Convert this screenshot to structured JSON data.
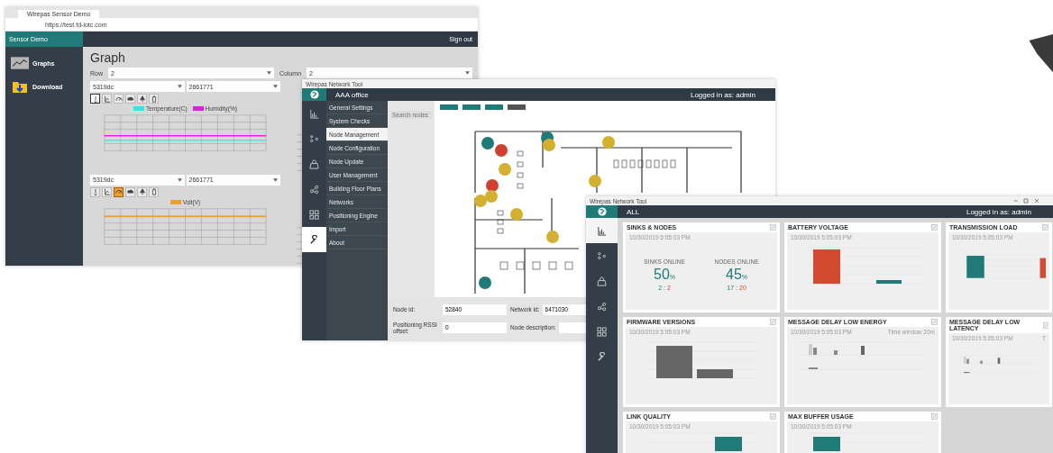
{
  "sensor_window": {
    "tab_title": "Wirepas Sensor Demo",
    "url": "https://test.fd-iotc.com",
    "app_name": "Sensor Demo",
    "sign_out": "Sign out",
    "sidebar": [
      {
        "label": "Graphs",
        "selected": true
      },
      {
        "label": "Download",
        "selected": false
      }
    ],
    "page_title": "Graph",
    "row": {
      "label": "Row",
      "value": "2"
    },
    "column": {
      "label": "Column",
      "value": "2"
    },
    "panels": [
      {
        "selects": [
          "5319dc",
          "2661771"
        ],
        "tools": [
          {
            "selected": true
          },
          {
            "selected": false
          },
          {
            "selected": false
          },
          {
            "selected": false
          },
          {
            "selected": false
          },
          {
            "selected": false
          }
        ],
        "legend": [
          {
            "name": "Temperature(C)",
            "color": "#3fe0e0"
          },
          {
            "name": "Humidity(%)",
            "color": "#e020e0"
          }
        ]
      },
      {
        "selects": [
          "5319dc",
          "2661771"
        ],
        "tools": [
          {
            "selected": false
          },
          {
            "selected": false
          },
          {
            "selected": true
          },
          {
            "selected": false
          },
          {
            "selected": false
          },
          {
            "selected": false
          }
        ],
        "legend": [
          {
            "name": "Volt(V)",
            "color": "#f0a030"
          }
        ]
      }
    ]
  },
  "network_window": {
    "window_title": "Wirepas Network Tool",
    "location": "AAA office",
    "login": "Logged in as: admin",
    "rail": [
      {
        "selected": false
      },
      {
        "selected": false
      },
      {
        "selected": false
      },
      {
        "selected": false
      },
      {
        "selected": false
      },
      {
        "selected": true
      }
    ],
    "menu": [
      {
        "label": "General Settings",
        "selected": false
      },
      {
        "label": "System Checks",
        "selected": false
      },
      {
        "label": "Node Management",
        "selected": true
      },
      {
        "label": "Node Configuration",
        "selected": false
      },
      {
        "label": "Node Update",
        "selected": false
      },
      {
        "label": "User Management",
        "selected": false
      },
      {
        "label": "Building Floor Plans",
        "selected": false
      },
      {
        "label": "Networks",
        "selected": false
      },
      {
        "label": "Positioning Engine",
        "selected": false
      },
      {
        "label": "Import",
        "selected": false
      },
      {
        "label": "About",
        "selected": false
      }
    ],
    "search": {
      "placeholder": "Search nodes"
    },
    "fields": [
      {
        "label": "Node id:",
        "value": "52840"
      },
      {
        "label": "Network id:",
        "value": "6471030"
      },
      {
        "label": "Positioning RSSI offset:",
        "value": "0"
      },
      {
        "label": "Node description:"
      }
    ]
  },
  "dashboard_window": {
    "window_title": "Wirepas Network Tool",
    "location": "ALL",
    "login": "Logged in as: admin",
    "rail": [
      {
        "selected": true
      },
      {
        "selected": false
      },
      {
        "selected": false
      },
      {
        "selected": false
      },
      {
        "selected": false
      },
      {
        "selected": false
      }
    ],
    "cards": [
      {
        "kind": "stats",
        "title": "SINKS & NODES",
        "date": "10/30/2019 5:05:03 PM",
        "stats": [
          {
            "label": "SINKS ONLINE",
            "value": "50",
            "unit": "%",
            "counts": [
              "2",
              ":",
              "2"
            ]
          },
          {
            "label": "NODES ONLINE",
            "value": "45",
            "unit": "%",
            "counts": [
              "17",
              ":",
              "20"
            ]
          }
        ]
      },
      {
        "kind": "battery",
        "title": "BATTERY VOLTAGE",
        "date": "10/30/2019 5:05:03 PM"
      },
      {
        "kind": "load",
        "title": "TRANSMISSION LOAD",
        "date": "10/30/2019 5:05:03 PM"
      },
      {
        "kind": "firmware",
        "title": "FIRMWARE VERSIONS",
        "date": "10/30/2019 5:05:03 PM"
      },
      {
        "kind": "delay",
        "title": "MESSAGE DELAY LOW ENERGY",
        "date": "10/30/2019 5:05:03 PM",
        "window": "Time window 20m"
      },
      {
        "kind": "delay",
        "title": "MESSAGE DELAY LOW LATENCY",
        "date": "10/30/2019 5:05:03 PM",
        "window": "T"
      },
      {
        "kind": "link",
        "title": "LINK QUALITY",
        "date": "10/30/2019 5:05:03 PM"
      },
      {
        "kind": "buffer",
        "title": "MAX BUFFER USAGE",
        "date": "10/30/2019 5:05:03 PM"
      }
    ]
  }
}
